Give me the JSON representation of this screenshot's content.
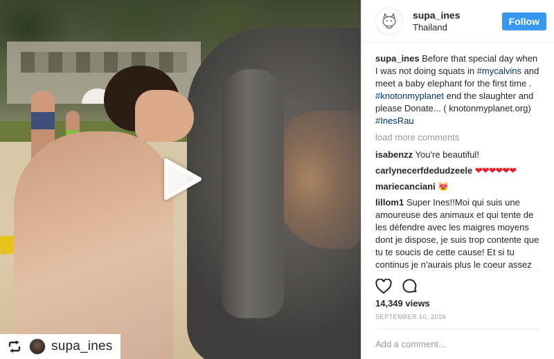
{
  "post": {
    "username": "supa_ines",
    "location": "Thailand",
    "follow_label": "Follow",
    "caption": {
      "author": "supa_ines",
      "parts": [
        {
          "text": "Before that special day when I was not doing squats in ",
          "tag": false
        },
        {
          "text": "#mycalvins",
          "tag": true
        },
        {
          "text": " and meet a baby elephant for the first time . ",
          "tag": false
        },
        {
          "text": "#knotonmyplanet",
          "tag": true
        },
        {
          "text": " end the slaughter and please Donate... ( knotonmyplanet.org) ",
          "tag": false
        },
        {
          "text": "#InesRau",
          "tag": true
        }
      ]
    },
    "load_more_label": "load more comments",
    "comments": [
      {
        "user": "isabenzz",
        "text": "You're beautiful!"
      },
      {
        "user": "carlynecerfdedudzeele",
        "text": "",
        "hearts": "❤❤❤❤❤❤"
      },
      {
        "user": "mariecanciani",
        "text": "😻"
      },
      {
        "user": "lillom1",
        "text": "Super Ines!!Moi qui suis une amoureuse des animaux et qui tente de les défendre avec les maigres moyens dont je dispose, je suis trop contente que tu te soucis de cette cause! Et si tu continus je n'aurais plus le coeur assez gros pour pouvoir t'aimer ^^( ) !!!! Mouak d'amour !!! Et toutes et tous, soucions nous des autres éspèces et ne tolérons"
      }
    ],
    "views": "14,349 views",
    "date": "SEPTEMBER 10, 2016",
    "add_comment_placeholder": "Add a comment...",
    "repost_username": "supa_ines"
  },
  "colors": {
    "follow_button": "#3897f0",
    "hashtag": "#003569",
    "muted_text": "#999999",
    "hearts": "#ed1c24"
  },
  "icons": {
    "play": "play-icon",
    "like": "heart-outline-icon",
    "comment": "comment-bubble-icon",
    "repost": "repost-icon",
    "avatar": "cartoon-cat-avatar"
  }
}
